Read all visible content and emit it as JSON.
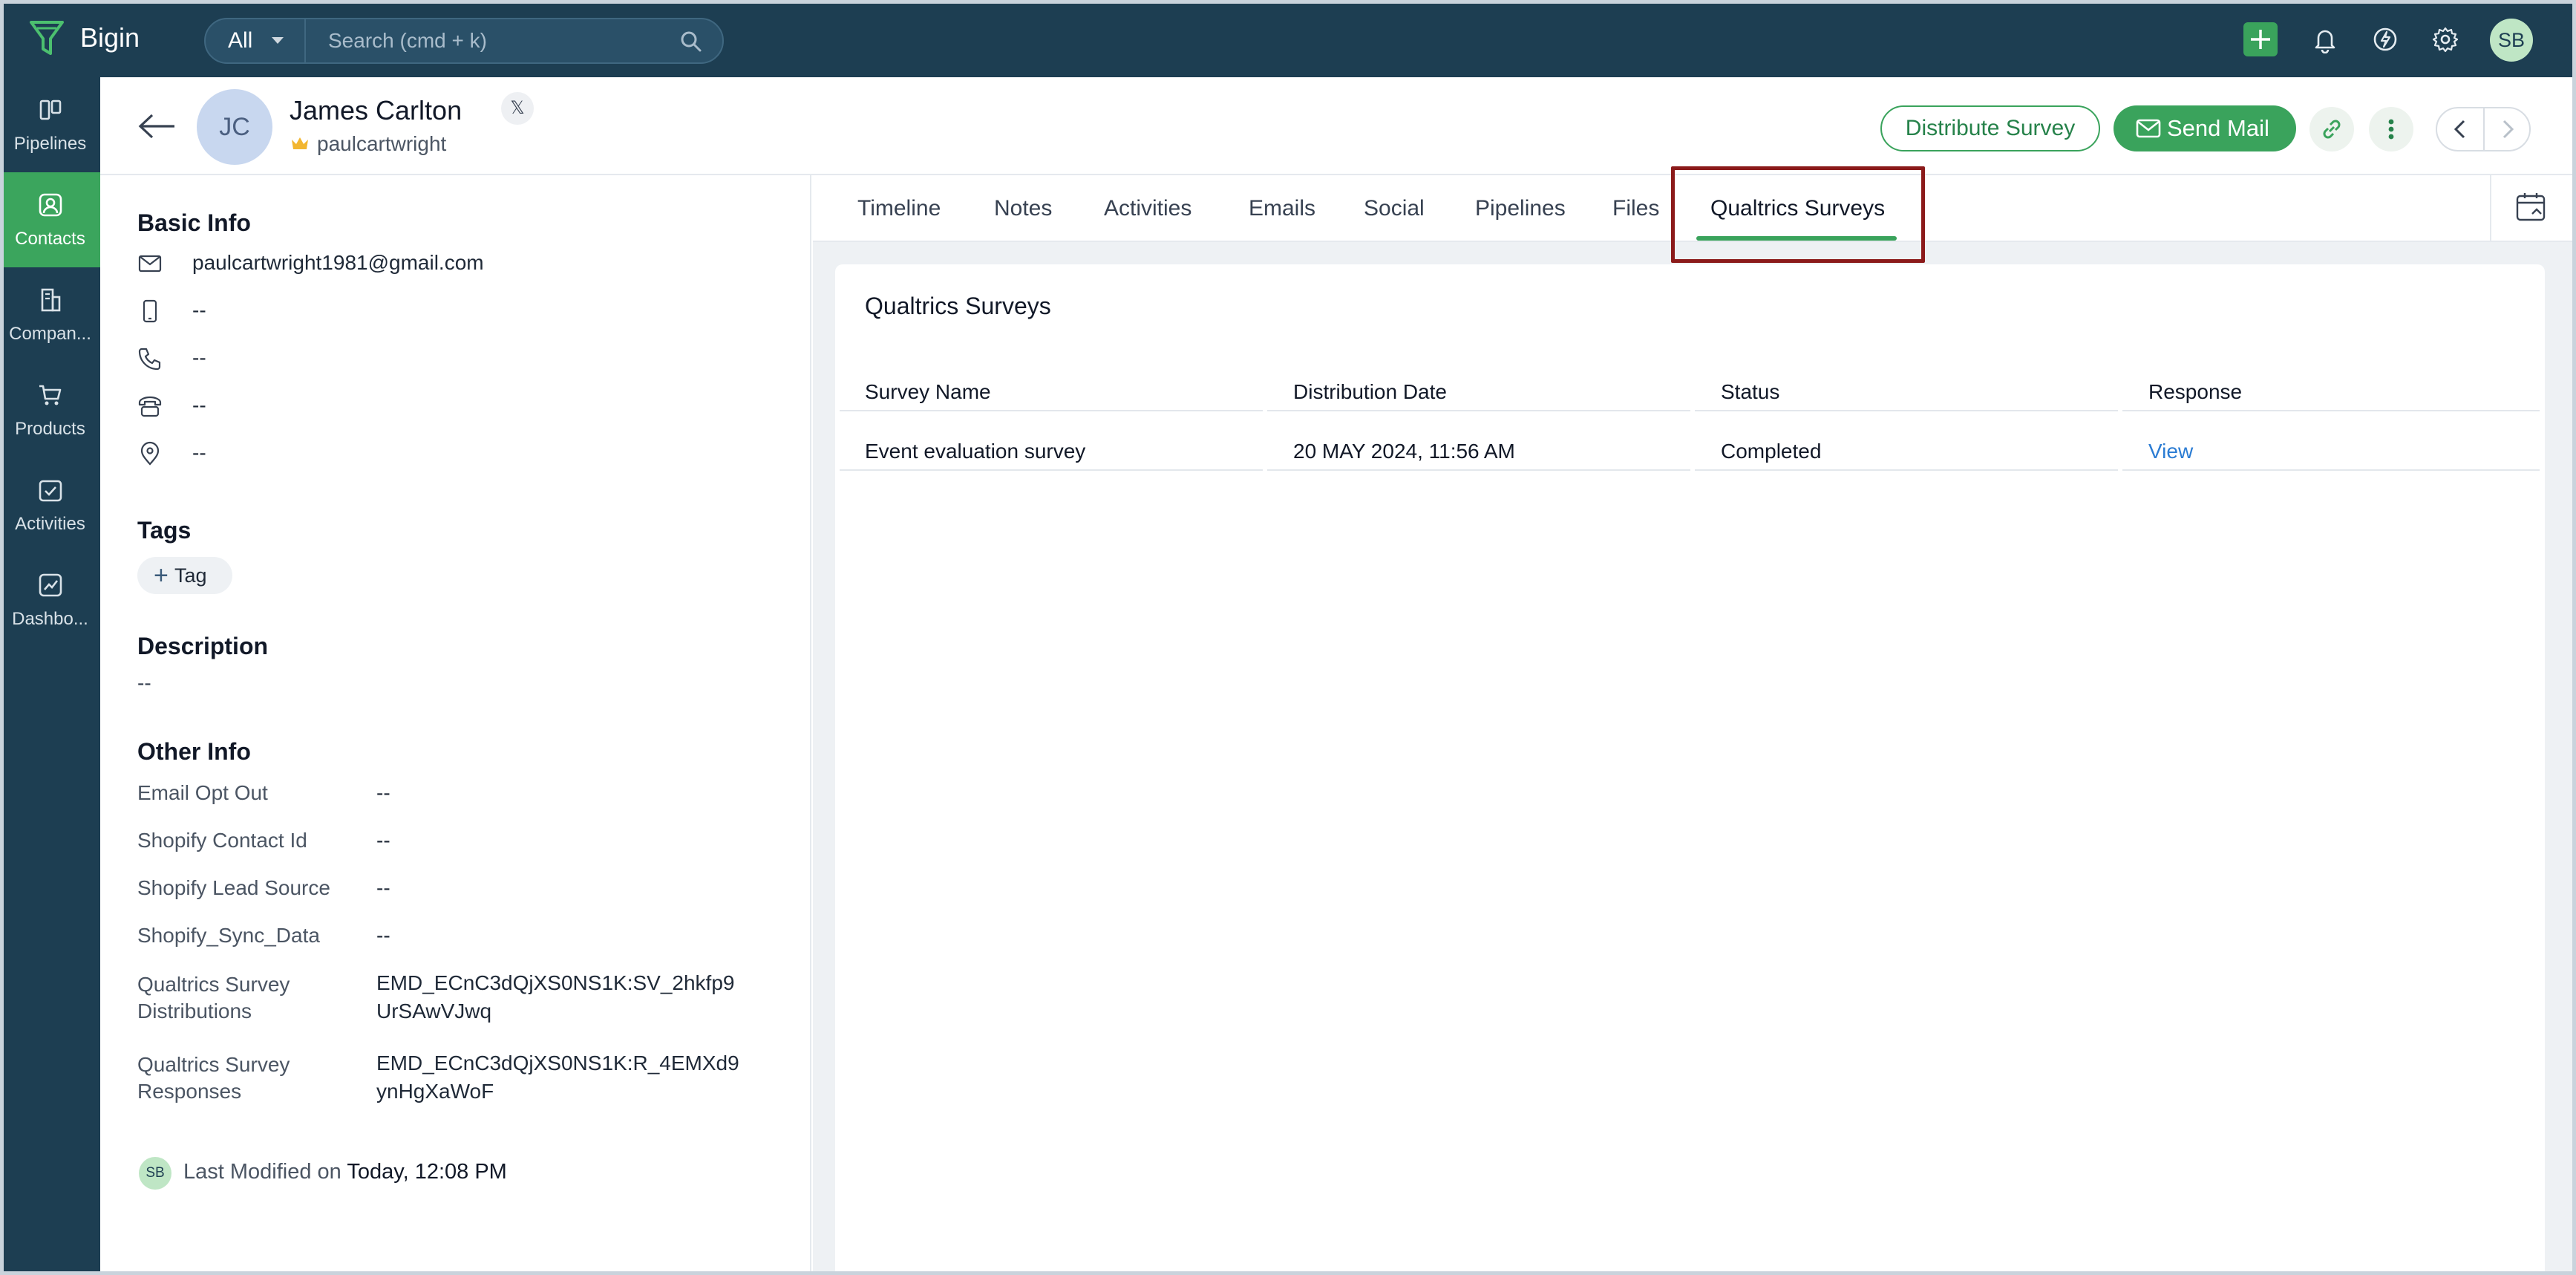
{
  "app": {
    "brand": "Bigin"
  },
  "topbar": {
    "search_scope": "All",
    "search_placeholder": "Search (cmd + k)",
    "user_initials": "SB",
    "accent": "#3aa35c"
  },
  "sidenav": {
    "items": [
      {
        "label": "Pipelines",
        "icon": "pipelines-icon",
        "active": false
      },
      {
        "label": "Contacts",
        "icon": "contacts-icon",
        "active": true
      },
      {
        "label": "Compan...",
        "icon": "companies-icon",
        "active": false
      },
      {
        "label": "Products",
        "icon": "products-icon",
        "active": false
      },
      {
        "label": "Activities",
        "icon": "activities-icon",
        "active": false
      },
      {
        "label": "Dashbo...",
        "icon": "dashboards-icon",
        "active": false
      }
    ]
  },
  "contact": {
    "initials": "JC",
    "name": "James Carlton",
    "handle": "paulcartwright",
    "social_badge": "𝕏"
  },
  "header_actions": {
    "distribute_label": "Distribute Survey",
    "send_mail_label": "Send Mail"
  },
  "basic_info": {
    "title": "Basic Info",
    "email": "paulcartwright1981@gmail.com",
    "mobile": "--",
    "phone": "--",
    "home_phone": "--",
    "address": "--"
  },
  "tags": {
    "title": "Tags",
    "add_label": "Tag"
  },
  "description": {
    "title": "Description",
    "value": "--"
  },
  "other_info": {
    "title": "Other Info",
    "fields": [
      {
        "label": "Email Opt Out",
        "value": "--"
      },
      {
        "label": "Shopify Contact Id",
        "value": "--"
      },
      {
        "label": "Shopify Lead Source",
        "value": "--"
      },
      {
        "label": "Shopify_Sync_Data",
        "value": "--"
      },
      {
        "label": "Qualtrics Survey Distributions",
        "value": "EMD_ECnC3dQjXS0NS1K:SV_2hkfp9UrSAwVJwq"
      },
      {
        "label": "Qualtrics Survey Responses",
        "value": "EMD_ECnC3dQjXS0NS1K:R_4EMXd9ynHgXaWoF"
      }
    ]
  },
  "last_modified": {
    "initials": "SB",
    "prefix": "Last Modified on",
    "value": "Today, 12:08 PM"
  },
  "tabs": [
    "Timeline",
    "Notes",
    "Activities",
    "Emails",
    "Social",
    "Pipelines",
    "Files",
    "Qualtrics Surveys"
  ],
  "active_tab": "Qualtrics Surveys",
  "surveys": {
    "title": "Qualtrics Surveys",
    "columns": [
      "Survey Name",
      "Distribution Date",
      "Status",
      "Response"
    ],
    "rows": [
      {
        "name": "Event evaluation survey",
        "date": "20 MAY 2024, 11:56 AM",
        "status": "Completed",
        "response": "View"
      }
    ]
  }
}
